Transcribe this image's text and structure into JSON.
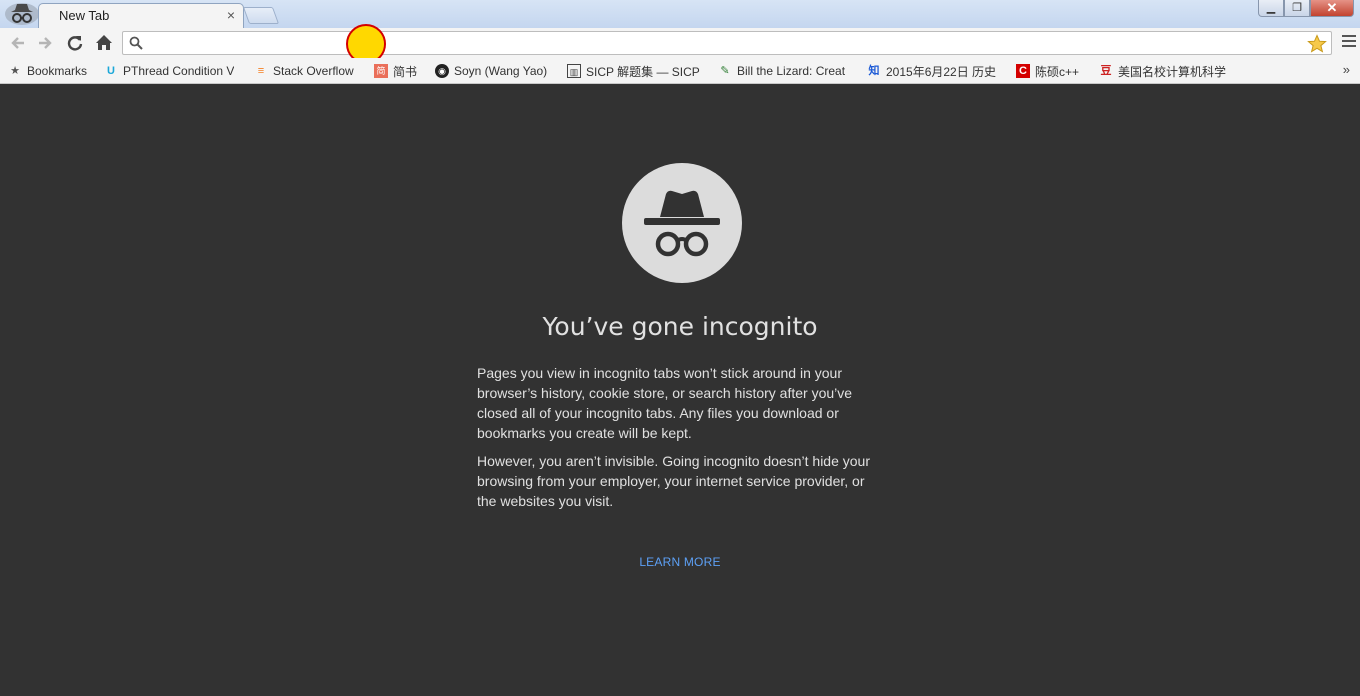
{
  "browser": {
    "tab": {
      "title": "New Tab",
      "close_label": "×"
    },
    "window_controls": {
      "minimize": "▁",
      "maximize": "❐",
      "close": "✕"
    },
    "icons": {
      "back": "arrow-left-icon",
      "forward": "arrow-right-icon",
      "reload": "reload-icon",
      "home": "home-icon",
      "search": "search-icon",
      "star": "star-icon",
      "menu": "hamburger-menu-icon"
    },
    "omnibox": {
      "value": "",
      "placeholder": ""
    },
    "bookmarks": [
      {
        "label": "Bookmarks",
        "icon": "star-icon",
        "color": "#555555"
      },
      {
        "label": "PThread Condition V",
        "icon": "u-logo-icon",
        "color": "#1aa7d8"
      },
      {
        "label": "Stack Overflow",
        "icon": "stackoverflow-icon",
        "color": "#f48024"
      },
      {
        "label": "简书",
        "icon": "jianshu-icon",
        "color": "#ea6f5a"
      },
      {
        "label": "Soyn (Wang Yao)",
        "icon": "github-icon",
        "color": "#222222"
      },
      {
        "label": "SICP 解题集 — SICP",
        "icon": "book-icon",
        "color": "#444444"
      },
      {
        "label": "Bill the Lizard: Creat",
        "icon": "lizard-icon",
        "color": "#2e7d32"
      },
      {
        "label": "2015年6月22日 历史",
        "icon": "zhihu-icon",
        "color": "#1e5bd6"
      },
      {
        "label": "陈硕c++",
        "icon": "csdn-icon",
        "color": "#d40000"
      },
      {
        "label": "美国名校计算机科学",
        "icon": "douban-icon",
        "color": "#cc2222"
      }
    ],
    "overflow": "»"
  },
  "page": {
    "icon": "incognito-spy-icon",
    "headline": "You’ve gone incognito",
    "paragraph1": "Pages you view in incognito tabs won’t stick around in your browser’s history, cookie store, or search history after you’ve closed all of your incognito tabs. Any files you download or bookmarks you create will be kept.",
    "paragraph2": "However, you aren’t invisible. Going incognito doesn’t hide your browsing from your employer, your internet service provider, or the websites you visit.",
    "learn_more": "LEARN MORE"
  },
  "colors": {
    "page_bg": "#323232",
    "text": "#e0e0e0",
    "link": "#5da0f5",
    "icon_circle": "#dcdcdc",
    "click_marker_fill": "#ffd800",
    "click_marker_ring": "#d40000"
  }
}
